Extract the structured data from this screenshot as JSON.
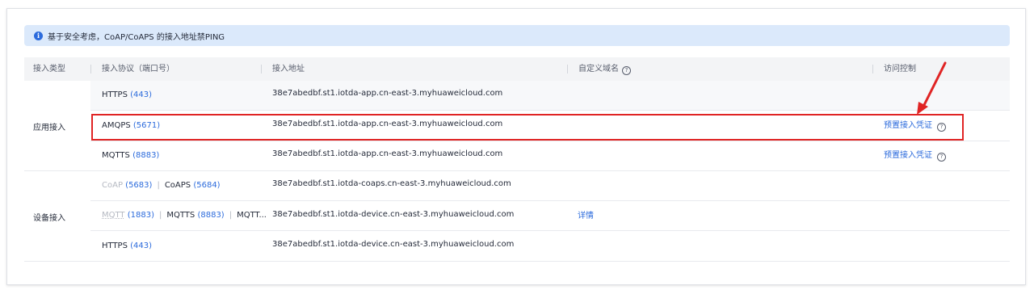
{
  "banner": {
    "text": "基于安全考虑，CoAP/CoAPS 的接入地址禁PING"
  },
  "table": {
    "headers": {
      "type": "接入类型",
      "protocol": "接入协议（端口号）",
      "address": "接入地址",
      "domain": "自定义域名",
      "access": "访问控制"
    },
    "groups": [
      {
        "label": "应用接入"
      },
      {
        "label": "设备接入"
      }
    ],
    "rows": [
      {
        "proto": "HTTPS",
        "port": "(443)",
        "address": "38e7abedbf.st1.iotda-app.cn-east-3.myhuaweicloud.com"
      },
      {
        "proto": "AMQPS",
        "port": "(5671)",
        "address": "38e7abedbf.st1.iotda-app.cn-east-3.myhuaweicloud.com",
        "access": "预置接入凭证"
      },
      {
        "proto": "MQTTS",
        "port": "(8883)",
        "address": "38e7abedbf.st1.iotda-app.cn-east-3.myhuaweicloud.com",
        "access": "预置接入凭证"
      },
      {
        "proto_a": "CoAP",
        "port_a": "(5683)",
        "proto_b": "CoAPS",
        "port_b": "(5684)",
        "address": "38e7abedbf.st1.iotda-coaps.cn-east-3.myhuaweicloud.com"
      },
      {
        "proto_a": "MQTT",
        "port_a": "(1883)",
        "proto_b": "MQTTS",
        "port_b": "(8883)",
        "proto_c": "MQTT...",
        "address": "38e7abedbf.st1.iotda-device.cn-east-3.myhuaweicloud.com",
        "domain_link": "详情"
      },
      {
        "proto": "HTTPS",
        "port": "(443)",
        "address": "38e7abedbf.st1.iotda-device.cn-east-3.myhuaweicloud.com"
      }
    ],
    "separator": "|"
  },
  "icons": {
    "info": "info-icon",
    "help": "question-circle-icon",
    "annotation": "red-arrow-icon"
  },
  "colors": {
    "link": "#2c6bdc",
    "highlight": "#e02424",
    "banner_bg": "#dbe9fb"
  }
}
